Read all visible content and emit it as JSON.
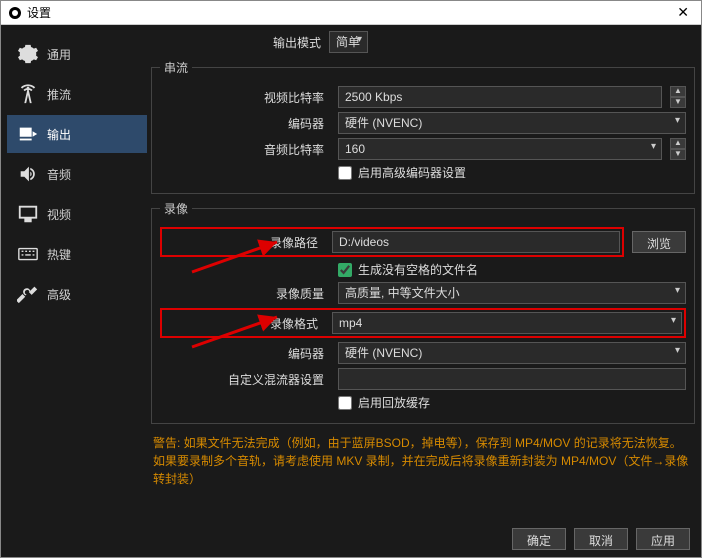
{
  "window": {
    "title": "设置",
    "close": "✕"
  },
  "sidebar": {
    "items": [
      {
        "label": "通用"
      },
      {
        "label": "推流"
      },
      {
        "label": "输出"
      },
      {
        "label": "音频"
      },
      {
        "label": "视频"
      },
      {
        "label": "热键"
      },
      {
        "label": "高级"
      }
    ]
  },
  "output": {
    "mode_label": "输出模式",
    "mode_value": "简单",
    "stream": {
      "legend": "串流",
      "video_bitrate_label": "视频比特率",
      "video_bitrate_value": "2500 Kbps",
      "encoder_label": "编码器",
      "encoder_value": "硬件 (NVENC)",
      "audio_bitrate_label": "音频比特率",
      "audio_bitrate_value": "160",
      "advanced_checkbox": "启用高级编码器设置"
    },
    "record": {
      "legend": "录像",
      "path_label": "录像路径",
      "path_value": "D:/videos",
      "browse": "浏览",
      "nospace_checkbox": "生成没有空格的文件名",
      "quality_label": "录像质量",
      "quality_value": "高质量, 中等文件大小",
      "format_label": "录像格式",
      "format_value": "mp4",
      "encoder_label": "编码器",
      "encoder_value": "硬件 (NVENC)",
      "muxer_label": "自定义混流器设置",
      "muxer_value": "",
      "replay_checkbox": "启用回放缓存"
    },
    "warning": "警告: 如果文件无法完成（例如，由于蓝屏BSOD，掉电等），保存到 MP4/MOV 的记录将无法恢复。如果要录制多个音轨，请考虑使用 MKV 录制，并在完成后将录像重新封装为 MP4/MOV（文件→录像转封装）"
  },
  "buttons": {
    "ok": "确定",
    "cancel": "取消",
    "apply": "应用"
  }
}
